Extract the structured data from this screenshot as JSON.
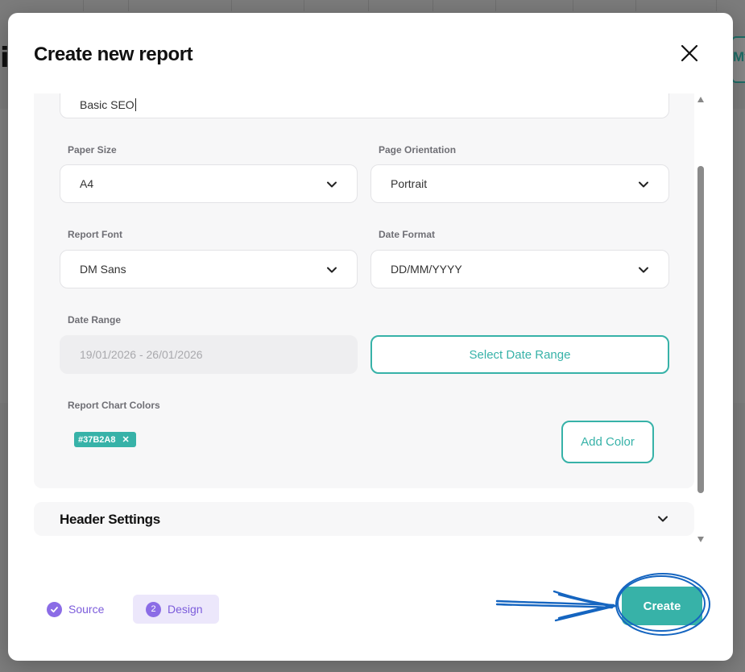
{
  "modal": {
    "title": "Create new report"
  },
  "form": {
    "report_name_value": "Basic SEO",
    "paper_size": {
      "label": "Paper Size",
      "value": "A4"
    },
    "page_orientation": {
      "label": "Page Orientation",
      "value": "Portrait"
    },
    "report_font": {
      "label": "Report Font",
      "value": "DM Sans"
    },
    "date_format": {
      "label": "Date Format",
      "value": "DD/MM/YYYY"
    },
    "date_range": {
      "label": "Date Range",
      "value": "19/01/2026 - 26/01/2026",
      "button": "Select Date Range"
    },
    "chart_colors": {
      "label": "Report Chart Colors",
      "colors": [
        "#37B2A8"
      ],
      "add_button": "Add Color"
    }
  },
  "sections": {
    "header_settings": "Header Settings"
  },
  "footer": {
    "steps": [
      {
        "label": "Source",
        "state": "completed",
        "icon": "check-icon"
      },
      {
        "label": "Design",
        "state": "active",
        "number": "2"
      }
    ],
    "create_button": "Create"
  },
  "background": {
    "left_glyph": "i",
    "right_tab": "My"
  },
  "colors": {
    "accent": "#37B2A8",
    "step_purple": "#7C5CDB",
    "annotation_blue": "#1565C0"
  }
}
